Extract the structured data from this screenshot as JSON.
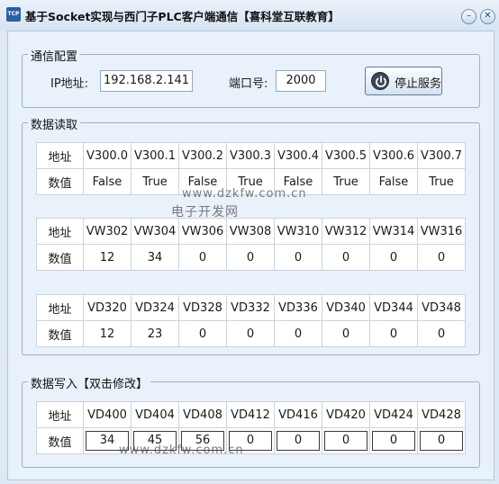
{
  "window": {
    "icon_text": "TCP",
    "title": "基于Socket实现与西门子PLC客户端通信【喜科堂互联教育】",
    "min_label": "–",
    "close_label": "✕"
  },
  "config": {
    "group_title": "通信配置",
    "ip_label": "IP地址:",
    "ip_value": "192.168.2.141",
    "port_label": "端口号:",
    "port_value": "2000",
    "stop_button_label": "停止服务",
    "stop_button_icon": "power-icon"
  },
  "read": {
    "group_title": "数据读取",
    "address_label": "地址",
    "value_label": "数值",
    "bits": {
      "addresses": [
        "V300.0",
        "V300.1",
        "V300.2",
        "V300.3",
        "V300.4",
        "V300.5",
        "V300.6",
        "V300.7"
      ],
      "values": [
        "False",
        "True",
        "False",
        "True",
        "False",
        "True",
        "False",
        "True"
      ]
    },
    "words": {
      "addresses": [
        "VW302",
        "VW304",
        "VW306",
        "VW308",
        "VW310",
        "VW312",
        "VW314",
        "VW316"
      ],
      "values": [
        "12",
        "34",
        "0",
        "0",
        "0",
        "0",
        "0",
        "0"
      ]
    },
    "dwords": {
      "addresses": [
        "VD320",
        "VD324",
        "VD328",
        "VD332",
        "VD336",
        "VD340",
        "VD344",
        "VD348"
      ],
      "values": [
        "12",
        "23",
        "0",
        "0",
        "0",
        "0",
        "0",
        "0"
      ]
    }
  },
  "write": {
    "group_title": "数据写入【双击修改】",
    "address_label": "地址",
    "value_label": "数值",
    "addresses": [
      "VD400",
      "VD404",
      "VD408",
      "VD412",
      "VD416",
      "VD420",
      "VD424",
      "VD428"
    ],
    "values": [
      "34",
      "45",
      "56",
      "0",
      "0",
      "0",
      "0",
      "0"
    ]
  },
  "watermarks": {
    "url_1": "www.dzkfw.com.cn",
    "site_name": "电子开发网",
    "url_2": "www.dzkfw.com.cn"
  }
}
